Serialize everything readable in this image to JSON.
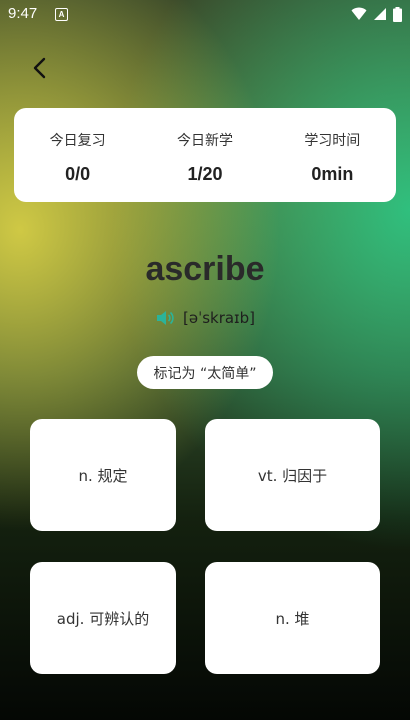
{
  "status_bar": {
    "time": "9:47",
    "app_icon_letter": "A",
    "icons": [
      "wifi-icon",
      "signal-icon",
      "battery-icon"
    ]
  },
  "nav": {
    "back_icon": "chevron-left-icon"
  },
  "stats": {
    "review": {
      "label": "今日复习",
      "value": "0/0"
    },
    "new": {
      "label": "今日新学",
      "value": "1/20"
    },
    "time": {
      "label": "学习时间",
      "value": "0min"
    }
  },
  "word": {
    "text": "ascribe",
    "phonetic": "[əˈskraɪb]",
    "speaker_icon": "speaker-icon"
  },
  "mark_easy_label": "标记为 “太简单”",
  "options": [
    {
      "label": "n. 规定"
    },
    {
      "label": "vt. 归因于"
    },
    {
      "label": "adj. 可辨认的"
    },
    {
      "label": "n. 堆"
    }
  ],
  "colors": {
    "accent_speaker": "#2bb39a",
    "gradient_yellow": "#d6ce46",
    "gradient_green": "#2ec482",
    "background_dark": "#040704"
  }
}
